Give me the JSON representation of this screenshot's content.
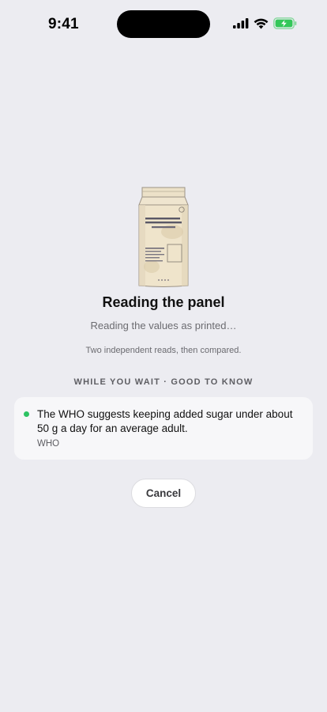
{
  "status_bar": {
    "time": "9:41",
    "icons": [
      "cellular-signal-icon",
      "wifi-icon",
      "battery-charging-icon"
    ],
    "battery_color": "#34c759"
  },
  "loader": {
    "illustration": "milk-carton-icon",
    "title": "Reading the panel",
    "subtitle": "Reading the values as printed…",
    "note": "Two independent reads, then compared."
  },
  "tips": {
    "section_label": "WHILE YOU WAIT · GOOD TO KNOW",
    "items": [
      {
        "text": "The WHO suggests keeping added sugar under about 50 g a day for an average adult.",
        "source": "WHO",
        "bullet_color": "#2ec363"
      }
    ]
  },
  "actions": {
    "cancel_label": "Cancel"
  }
}
